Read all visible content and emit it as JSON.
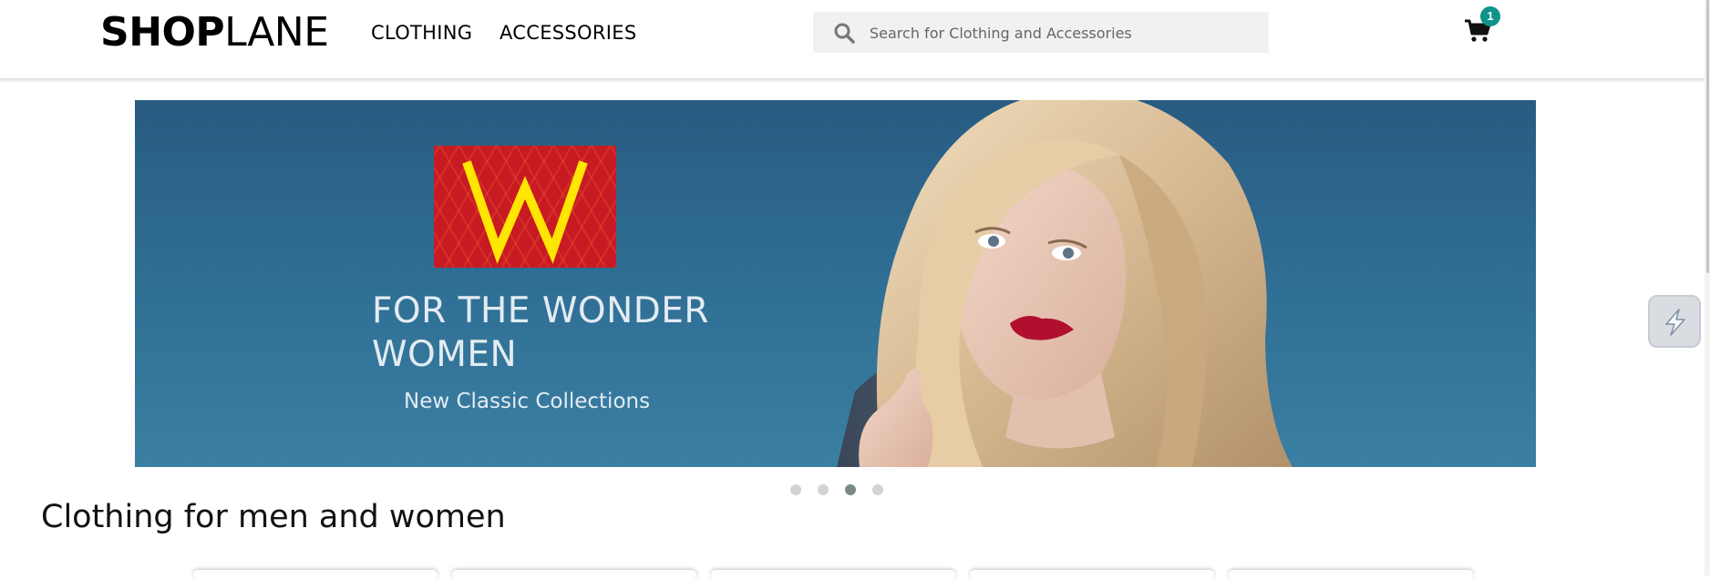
{
  "header": {
    "logo_bold": "SHOP",
    "logo_light": "LANE",
    "nav": [
      {
        "label": "CLOTHING"
      },
      {
        "label": "ACCESSORIES"
      }
    ],
    "search": {
      "placeholder": "Search for Clothing and Accessories",
      "icon": "search-icon"
    },
    "cart": {
      "icon": "cart-icon",
      "count": "1",
      "badge_color": "#0e9488"
    }
  },
  "banner": {
    "logo_letter": "W",
    "title": "FOR THE WONDER WOMEN",
    "subtitle": "New Classic Collections",
    "logo_bg_color": "#c81a22",
    "logo_letter_color": "#ffe600"
  },
  "carousel": {
    "slide_count": 4,
    "active_index": 2
  },
  "widget": {
    "icon": "lightning-extension-icon"
  },
  "section": {
    "title": "Clothing for men and women"
  }
}
